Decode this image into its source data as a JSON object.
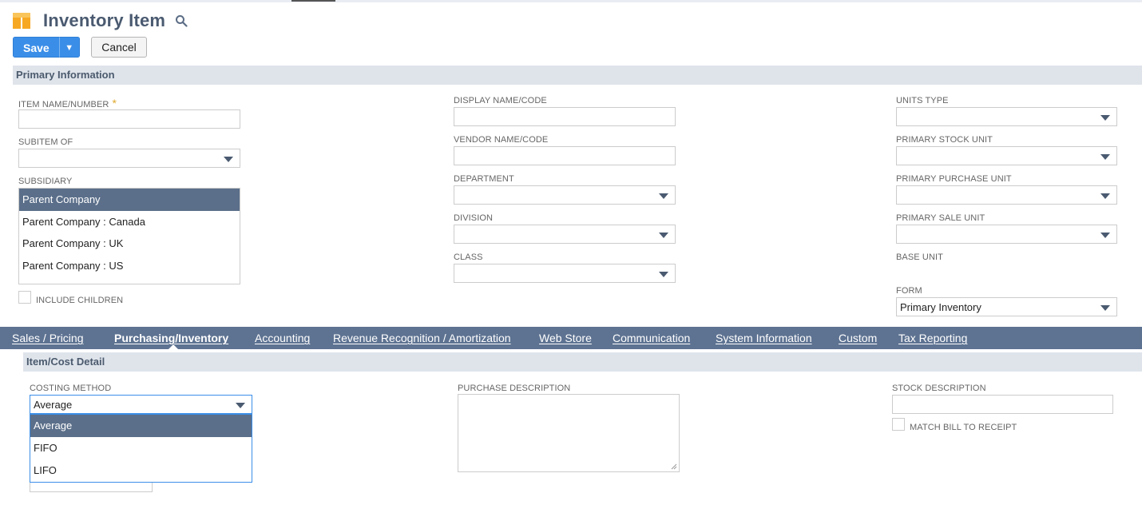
{
  "page": {
    "title": "Inventory Item",
    "icon": "inventory-item-icon",
    "search_icon": "search-icon"
  },
  "toolbar": {
    "save_label": "Save",
    "save_menu_arrow": "▼",
    "cancel_label": "Cancel"
  },
  "primary_information": {
    "section_title": "Primary Information",
    "item_name_label": "ITEM NAME/NUMBER",
    "item_name_required": "*",
    "item_name_value": "",
    "subitem_of_label": "SUBITEM OF",
    "subitem_of_value": "",
    "subsidiary_label": "SUBSIDIARY",
    "subsidiary_options": [
      "Parent Company",
      "Parent Company : Canada",
      "Parent Company : UK",
      "Parent Company : US"
    ],
    "subsidiary_selected": "Parent Company",
    "include_children_label": "INCLUDE CHILDREN",
    "include_children_checked": false,
    "display_name_label": "DISPLAY NAME/CODE",
    "vendor_name_label": "VENDOR NAME/CODE",
    "department_label": "DEPARTMENT",
    "division_label": "DIVISION",
    "class_label": "CLASS",
    "units_type_label": "UNITS TYPE",
    "primary_stock_unit_label": "PRIMARY STOCK UNIT",
    "primary_purchase_unit_label": "PRIMARY PURCHASE UNIT",
    "primary_sale_unit_label": "PRIMARY SALE UNIT",
    "base_unit_label": "BASE UNIT",
    "form_label": "FORM",
    "form_value": "Primary Inventory"
  },
  "tabs": [
    {
      "label": "Sales / Pricing",
      "active": false
    },
    {
      "label": "Purchasing/Inventory",
      "active": true
    },
    {
      "label": "Accounting",
      "active": false
    },
    {
      "label": "Revenue Recognition / Amortization",
      "active": false
    },
    {
      "label": "Web Store",
      "active": false
    },
    {
      "label": "Communication",
      "active": false
    },
    {
      "label": "System Information",
      "active": false
    },
    {
      "label": "Custom",
      "active": false
    },
    {
      "label": "Tax Reporting",
      "active": false
    }
  ],
  "item_cost_detail": {
    "section_title": "Item/Cost Detail",
    "costing_method_label": "COSTING METHOD",
    "costing_method_value": "Average",
    "costing_method_options": [
      "Average",
      "FIFO",
      "LIFO"
    ],
    "costing_method_selected": "Average",
    "purchase_description_label": "PURCHASE DESCRIPTION",
    "stock_description_label": "STOCK DESCRIPTION",
    "match_bill_label": "MATCH BILL TO RECEIPT",
    "match_bill_checked": false
  },
  "colors": {
    "accent": "#3b8ee8",
    "tab_bar": "#5e7392",
    "section_bar": "#dfe4eb",
    "selected_option": "#5b6f8a",
    "title": "#4a5a70",
    "required": "#e0a82e"
  }
}
